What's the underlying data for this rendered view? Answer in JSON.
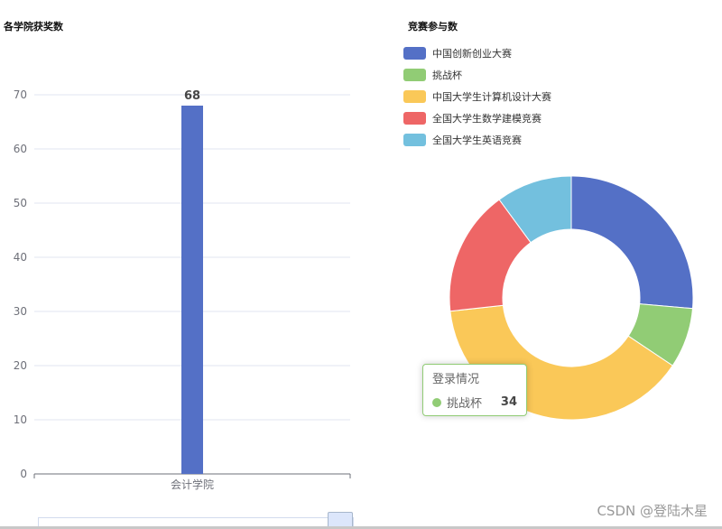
{
  "chart_data": [
    {
      "type": "bar",
      "title": "各学院获奖数",
      "categories": [
        "会计学院"
      ],
      "values": [
        68
      ],
      "ylim": [
        0,
        70
      ],
      "yticks": [
        0,
        10,
        20,
        30,
        40,
        50,
        60,
        70
      ],
      "color": "#5470c6",
      "data_label": "68"
    },
    {
      "type": "pie",
      "title": "竞赛参与数",
      "donut": true,
      "legend_position": "top-left",
      "slices": [
        {
          "name": "中国创新创业大赛",
          "value": 76,
          "color": "#5470c6"
        },
        {
          "name": "挑战杯",
          "value": 23,
          "color": "#91cc75"
        },
        {
          "name": "中国大学生计算机设计大赛",
          "value": 112,
          "color": "#fac858"
        },
        {
          "name": "全国大学生数学建模竞赛",
          "value": 48,
          "color": "#ee6666"
        },
        {
          "name": "全国大学生英语竞赛",
          "value": 29,
          "color": "#73c0de"
        }
      ],
      "tooltip": {
        "title": "登录情况",
        "name": "挑战杯",
        "value": "34",
        "color": "#91cc75"
      }
    }
  ],
  "watermark": "CSDN @登陆木星"
}
